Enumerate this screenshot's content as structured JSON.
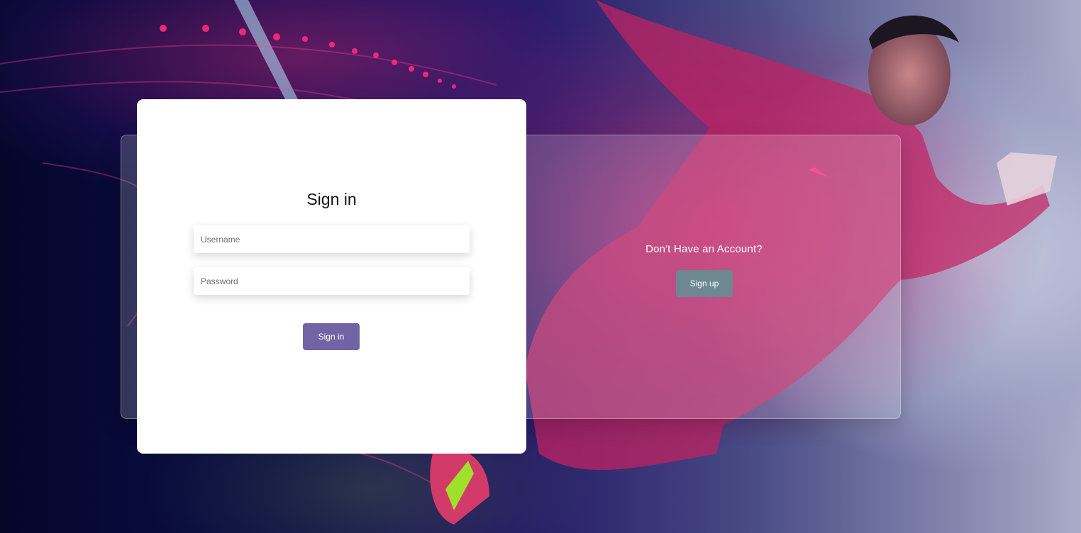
{
  "signin": {
    "title": "Sign in",
    "username_placeholder": "Username",
    "username_value": "",
    "password_placeholder": "Password",
    "password_value": "",
    "button_label": "Sign in"
  },
  "signup": {
    "prompt": "Don't Have an Account?",
    "button_label": "Sign up"
  },
  "colors": {
    "signin_button": "#7164a5",
    "signup_button": "#6d8891",
    "card_background": "#ffffff"
  }
}
